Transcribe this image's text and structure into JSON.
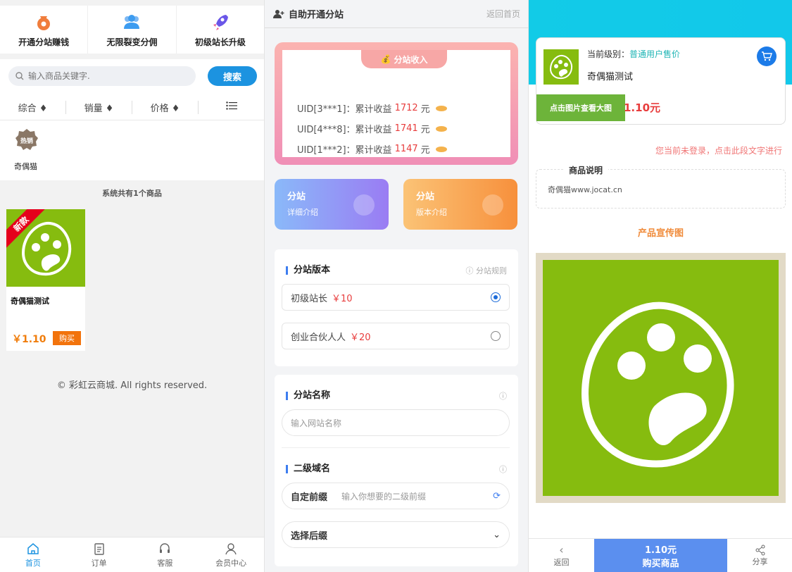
{
  "left": {
    "topnav": [
      {
        "label": "开通分站赚钱",
        "icon": "money-bag-icon",
        "color": "#f07d3c"
      },
      {
        "label": "无限裂变分佣",
        "icon": "users-icon",
        "color": "#3d9cf0"
      },
      {
        "label": "初级站长升级",
        "icon": "rocket-icon",
        "color": "#6a56e8"
      }
    ],
    "search": {
      "placeholder": "输入商品关键字.",
      "button": "搜索"
    },
    "sort": [
      "综合 ♦",
      "销量 ♦",
      "价格 ♦"
    ],
    "hot": {
      "badge": "热销",
      "label": "奇偶猫"
    },
    "count_text": "系统共有1个商品",
    "product": {
      "ribbon": "新款",
      "name": "奇偶猫测试",
      "price": "￥1.10",
      "buy": "购买"
    },
    "copyright": "© 彩虹云商城. All rights reserved.",
    "bottom_nav": [
      "首页",
      "订单",
      "客服",
      "会员中心"
    ]
  },
  "middle": {
    "title": "自助开通分站",
    "back": "返回首页",
    "income": {
      "tab": "分站收入",
      "rows": [
        {
          "uid": "UID[3***1]：",
          "label": "累计收益",
          "value": "1712",
          "unit": "元"
        },
        {
          "uid": "UID[4***8]：",
          "label": "累计收益",
          "value": "1741",
          "unit": "元"
        },
        {
          "uid": "UID[1***2]：",
          "label": "累计收益",
          "value": "1147",
          "unit": "元"
        }
      ]
    },
    "cards": [
      {
        "title": "分站",
        "sub": "详细介绍"
      },
      {
        "title": "分站",
        "sub": "版本介绍"
      }
    ],
    "version": {
      "title": "分站版本",
      "help": "ⓘ 分站规则",
      "options": [
        {
          "name": "初级站长",
          "price": "￥10",
          "selected": true
        },
        {
          "name": "创业合伙人人",
          "price": "￥20",
          "selected": false
        }
      ]
    },
    "name_section": {
      "title": "分站名称",
      "placeholder": "输入网站名称"
    },
    "domain_section": {
      "title": "二级域名",
      "prefix_label": "自定前缀",
      "prefix_placeholder": "输入你想要的二级前缀",
      "suffix_label": "选择后缀"
    }
  },
  "right": {
    "level_label": "当前级别：",
    "level_value": "普通用户售价",
    "product_name": "奇偶猫测试",
    "view_big": "点击图片查看大图",
    "price": "1.10元",
    "login_tip": "您当前未登录，点击此段文字进行",
    "desc_title": "商品说明",
    "desc_content": "奇偶猫www.jocat.cn",
    "promo_title": "产品宣传图",
    "bottom": {
      "back": "返回",
      "buy_price": "1.10元",
      "buy": "购买商品",
      "share": "分享"
    }
  }
}
